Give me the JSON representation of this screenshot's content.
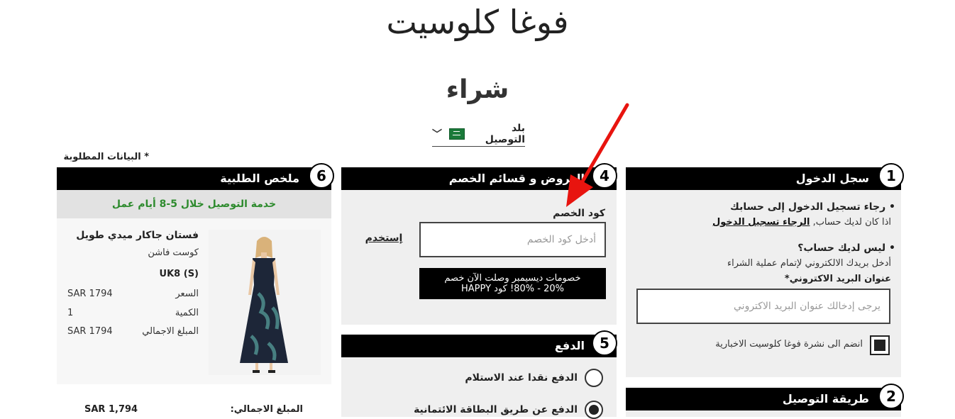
{
  "brand": "فوغا كلوسيت",
  "page_title": "شراء",
  "country": {
    "label": "بلد التوصيل",
    "flag_icon": "saudi-flag-icon"
  },
  "required_note": "* البيانات المطلوبة",
  "login": {
    "number": "1",
    "title": "سجل الدخول",
    "login_prompt": "رجاء تسجيل الدخول إلى حسابك",
    "have_account": "اذا كان لديك حساب,",
    "login_link": "الرجاء تسجيل الدخول",
    "no_account": "ليس لديك حساب؟",
    "enter_email": "أدخل بريدك الالكتروني لإتمام عملية الشراء",
    "email_label": "عنوان البريد الاكتروني*",
    "email_placeholder": "يرجى إدخالك عنوان البريد الاكتروني",
    "newsletter": "انضم الى نشرة فوغا كلوسيت الاخبارية"
  },
  "shipping": {
    "number": "2",
    "title": "طريقة التوصيل"
  },
  "offers": {
    "number": "4",
    "title": "العروض و قسائم الخصم",
    "code_label": "كود الخصم",
    "code_placeholder": "أدخل كود الخصم",
    "apply": "إستخدم",
    "promo_line1": "خصومات ديسيمبر وصلت الآن خصم",
    "promo_line2": "20% - 80%! كود HAPPY"
  },
  "payment": {
    "number": "5",
    "title": "الدفع",
    "options": [
      "الدفع نقدا عند الاستلام",
      "الدفع عن طريق البطاقة الائتمانية"
    ],
    "selected_index": 1
  },
  "summary": {
    "number": "6",
    "title": "ملخص الطلبية",
    "delivery_note": "خدمة التوصيل خلال 5-8 أيام عمل",
    "product_name": "فستان جاكار ميدي طويل",
    "product_brand": "كوست فاشن",
    "size": "UK8 (S)",
    "price_label": "السعر",
    "price_value": "SAR 1794",
    "qty_label": "الكمية",
    "qty_value": "1",
    "total_label": "المبلغ الاجمالي",
    "total_value": "SAR 1794",
    "grand_total_label": "المبلغ الاجمالي:",
    "grand_total_value": "SAR 1,794"
  },
  "colors": {
    "accent": "#000000",
    "panel": "#efefef",
    "green": "#2e8b2e",
    "arrow": "#e8140f"
  }
}
